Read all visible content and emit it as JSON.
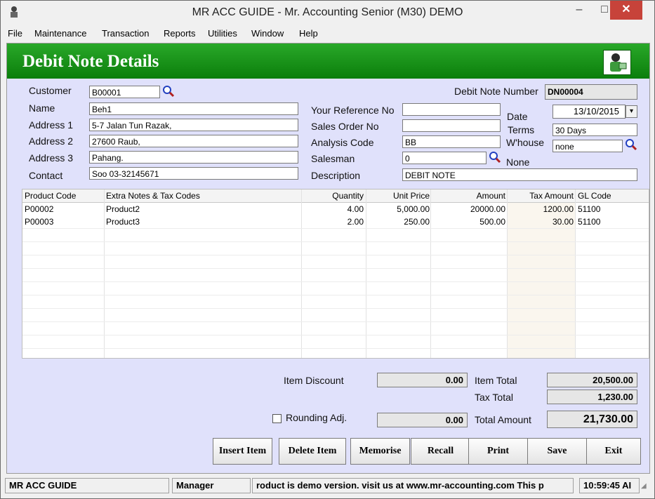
{
  "window": {
    "title": "MR ACC GUIDE - Mr. Accounting Senior (M30) DEMO",
    "minimize": "–",
    "maximize": "□",
    "close": "✕"
  },
  "menu": [
    "File",
    "Maintenance",
    "Transaction",
    "Reports",
    "Utilities",
    "Window",
    "Help"
  ],
  "header": {
    "title": "Debit Note Details",
    "icon": "accountant-icon"
  },
  "form": {
    "customer_label": "Customer",
    "customer": "B00001",
    "name_label": "Name",
    "name": "Beh1",
    "address1_label": "Address 1",
    "address1": "5-7 Jalan Tun Razak,",
    "address2_label": "Address 2",
    "address2": "27600 Raub,",
    "address3_label": "Address 3",
    "address3": "Pahang.",
    "contact_label": "Contact",
    "contact": "Soo   03-32145671",
    "your_ref_label": "Your Reference No",
    "your_ref": "",
    "sales_order_label": "Sales  Order No",
    "sales_order": "",
    "analysis_label": "Analysis Code",
    "analysis": "BB",
    "salesman_label": "Salesman",
    "salesman": "0",
    "salesman_name": "None",
    "description_label": "Description",
    "description": "DEBIT NOTE",
    "dn_number_label": "Debit Note Number",
    "dn_number": "DN00004",
    "date_label": "Date",
    "date": "13/10/2015",
    "terms_label": "Terms",
    "terms": "30 Days",
    "whouse_label": "W'house",
    "whouse": "none"
  },
  "grid": {
    "columns": [
      "Product Code",
      "Extra Notes & Tax Codes",
      "Quantity",
      "Unit Price",
      "Amount",
      "Tax Amount",
      "GL Code"
    ],
    "rows": [
      [
        "P00002",
        "Product2",
        "4.00",
        "5,000.00",
        "20000.00",
        "1200.00",
        "51100"
      ],
      [
        "P00003",
        "Product3",
        "2.00",
        "250.00",
        "500.00",
        "30.00",
        "51100"
      ]
    ]
  },
  "totals": {
    "item_discount_label": "Item Discount",
    "item_discount": "0.00",
    "item_total_label": "Item Total",
    "item_total": "20,500.00",
    "tax_total_label": "Tax Total",
    "tax_total": "1,230.00",
    "rounding_label": "Rounding Adj.",
    "rounding": "0.00",
    "total_amount_label": "Total Amount",
    "total_amount": "21,730.00"
  },
  "buttons": {
    "insert": "Insert Item",
    "delete": "Delete Item",
    "memorise": "Memorise",
    "recall": "Recall",
    "print": "Print",
    "save": "Save",
    "exit": "Exit"
  },
  "status": {
    "company": "MR ACC GUIDE",
    "user": "Manager",
    "message": "roduct is demo version.  visit us at www.mr-accounting.com This p",
    "time": "10:59:45 AI"
  },
  "colors": {
    "banner": "#1a951a",
    "client_bg": "#e0e1fb",
    "close_btn": "#c7433a"
  }
}
